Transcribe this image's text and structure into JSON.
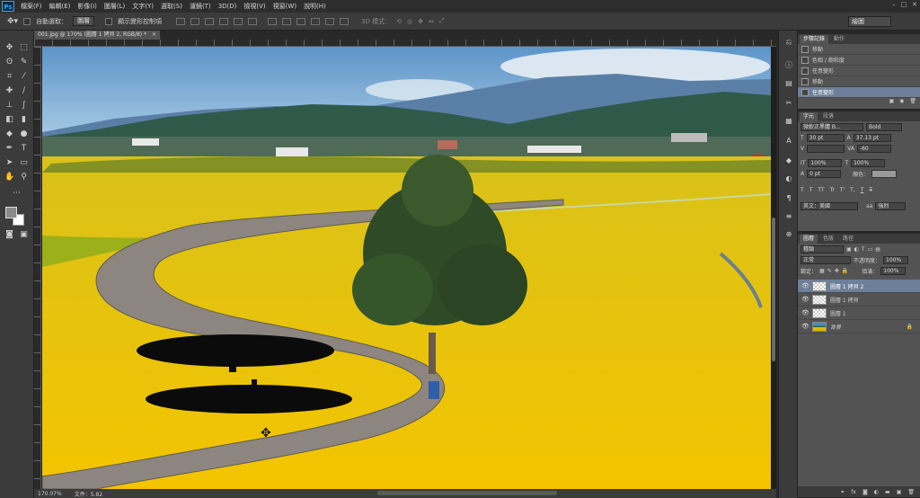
{
  "menubar": {
    "logo": "Ps",
    "items": [
      "檔案(F)",
      "編輯(E)",
      "影像(I)",
      "圖層(L)",
      "文字(Y)",
      "選取(S)",
      "濾鏡(T)",
      "3D(D)",
      "檢視(V)",
      "視窗(W)",
      "說明(H)"
    ]
  },
  "options": {
    "auto_select_label": "自動選取：",
    "auto_select_value": "圖層",
    "show_transform_label": "顯示變形控制項",
    "mode_3d_label": "3D 模式："
  },
  "workspace": {
    "label": "繪圖"
  },
  "document": {
    "tab_title": "001.jpg @ 170% (圖層 1 拷貝 2, RGB/8) *",
    "close": "×",
    "zoom": "170.07%",
    "file_size": "文件：5.82"
  },
  "history": {
    "tabs": [
      "步驟記錄",
      "動作"
    ],
    "rows": [
      "移動",
      "色相 / 飽和度",
      "任意變形",
      "移動",
      "任意變形"
    ]
  },
  "character": {
    "tabs": [
      "字元",
      "段落"
    ],
    "font_family": "微軟正黑體 B...",
    "font_style": "Bold",
    "size": "30 pt",
    "leading": "37.13 pt",
    "tracking": "-60",
    "scale_v": "100%",
    "scale_h": "100%",
    "baseline": "0 pt",
    "color_label": "顏色：",
    "language": "英文：美國",
    "aa": "強烈",
    "style_glyphs": [
      "T",
      "T",
      "TT",
      "Tr",
      "T'",
      "T,",
      "T",
      "T"
    ]
  },
  "layers": {
    "tabs": [
      "圖層",
      "色版",
      "路徑"
    ],
    "filter_kind": "種類",
    "blend_mode": "正常",
    "opacity_label": "不透明度：",
    "opacity": "100%",
    "lock_label": "鎖定：",
    "fill_label": "填滿：",
    "fill": "100%",
    "items": [
      {
        "name": "圖層 1 拷貝 2",
        "selected": true
      },
      {
        "name": "圖層 1 拷貝",
        "selected": false
      },
      {
        "name": "圖層 1",
        "selected": false
      },
      {
        "name": "背景",
        "selected": false
      }
    ]
  },
  "colors": {
    "selection": "#6d7f99",
    "panel": "#535353",
    "dark": "#282828",
    "accent": "#31a8ff"
  }
}
